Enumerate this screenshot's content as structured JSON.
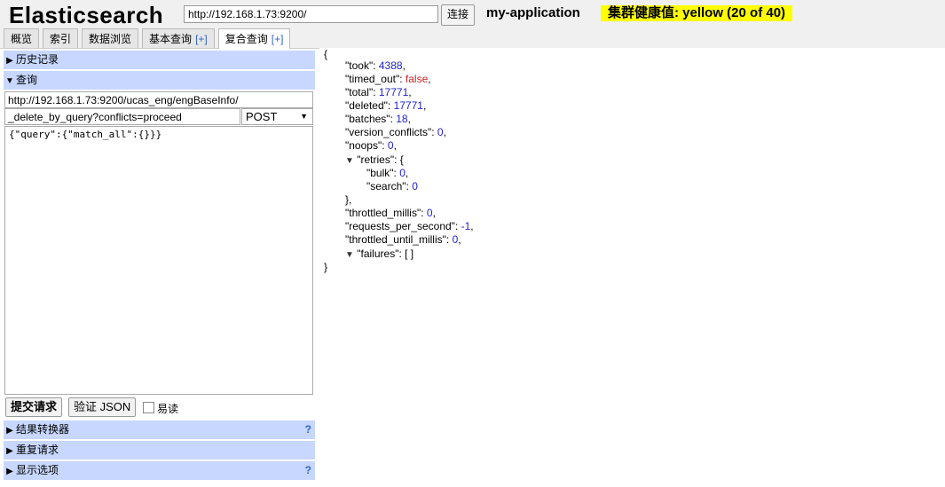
{
  "header": {
    "brand": "Elasticsearch",
    "url": "http://192.168.1.73:9200/",
    "connect_label": "连接",
    "cluster_name": "my-application",
    "health": "集群健康值: yellow (20 of 40)"
  },
  "tabs": [
    {
      "label": "概览",
      "plus": ""
    },
    {
      "label": "索引",
      "plus": ""
    },
    {
      "label": "数据浏览",
      "plus": ""
    },
    {
      "label": "基本查询",
      "plus": "[+]"
    },
    {
      "label": "复合查询",
      "plus": "[+]"
    }
  ],
  "left": {
    "history_label": "历史记录",
    "query_label": "查询",
    "query_url": "http://192.168.1.73:9200/ucas_eng/engBaseInfo/",
    "query_path": "_delete_by_query?conflicts=proceed",
    "method": "POST",
    "body": "{\"query\":{\"match_all\":{}}}",
    "submit_label": "提交请求",
    "validate_label": "验证 JSON",
    "pretty_label": "易读",
    "transformer_label": "结果转换器",
    "repeat_label": "重复请求",
    "display_label": "显示选项",
    "help": "?"
  },
  "result": {
    "open": "{",
    "close": "}",
    "took": {
      "key": "\"took\"",
      "value": "4388"
    },
    "timed_out": {
      "key": "\"timed_out\"",
      "value": "false"
    },
    "total": {
      "key": "\"total\"",
      "value": "17771"
    },
    "deleted": {
      "key": "\"deleted\"",
      "value": "17771"
    },
    "batches": {
      "key": "\"batches\"",
      "value": "18"
    },
    "version_conflicts": {
      "key": "\"version_conflicts\"",
      "value": "0"
    },
    "noops": {
      "key": "\"noops\"",
      "value": "0"
    },
    "retries": {
      "key": "\"retries\"",
      "open": "{",
      "close": "},"
    },
    "bulk": {
      "key": "\"bulk\"",
      "value": "0"
    },
    "search": {
      "key": "\"search\"",
      "value": "0"
    },
    "throttled_millis": {
      "key": "\"throttled_millis\"",
      "value": "0"
    },
    "requests_per_second": {
      "key": "\"requests_per_second\"",
      "value": "-1"
    },
    "throttled_until_millis": {
      "key": "\"throttled_until_millis\"",
      "value": "0"
    },
    "failures": {
      "key": "\"failures\"",
      "value": "[ ]"
    }
  },
  "colors": {
    "section_bg": "#c7d7ff",
    "health_bg": "#ffff00",
    "number": "#2222cc",
    "keyword": "#cc2222"
  },
  "icons": {
    "collapsed": "triangle-right-icon",
    "expanded": "triangle-down-icon"
  }
}
